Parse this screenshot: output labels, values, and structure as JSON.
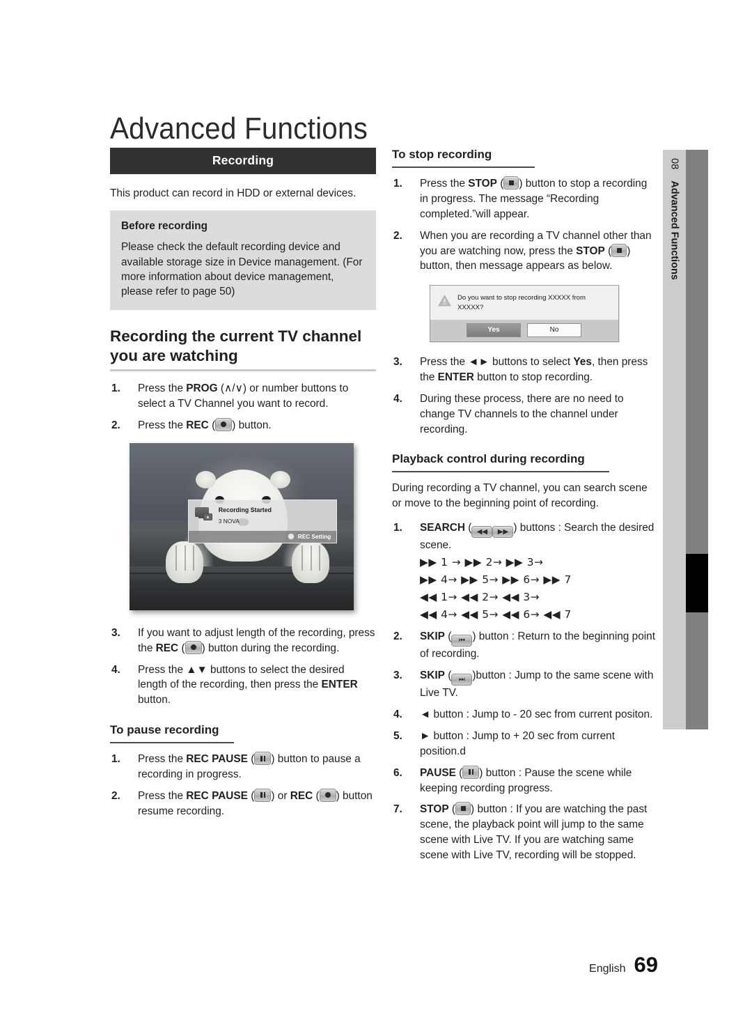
{
  "page_title": "Advanced Functions",
  "section_bar": {
    "label": "Recording"
  },
  "left": {
    "intro": "This product can record in HDD or external devices.",
    "note": {
      "title": "Before recording",
      "body": "Please check the default recording device and available storage size in Device management. (For more information about device management, please refer to page 50)"
    },
    "heading_record_current": "Recording the current TV channel you are watching",
    "steps_record": [
      {
        "num": "1.",
        "text_parts": [
          "Press the ",
          "PROG",
          " (∧/∨) or number buttons to select a TV Channel you want to record."
        ]
      },
      {
        "num": "2.",
        "text_parts": [
          "Press the ",
          "REC",
          " (",
          "rec-icon",
          ") button."
        ]
      }
    ],
    "figure": {
      "osd_title": "Recording Started",
      "osd_channel": "3 NOVA",
      "osd_footer": "REC Setting"
    },
    "steps_record_cont": [
      {
        "num": "3.",
        "text": "If you want to adjust length of the recording, press the REC ( ) button during the recording."
      },
      {
        "num": "4.",
        "text": "Press the ▲▼ buttons to select the desired length of the recording, then press the ENTER button."
      }
    ],
    "heading_pause": "To pause recording",
    "steps_pause": [
      {
        "num": "1.",
        "text": "Press the REC PAUSE ( ) button to pause a recording in progress."
      },
      {
        "num": "2.",
        "text": "Press the REC PAUSE ( ) or REC ( ) button resume recording."
      }
    ]
  },
  "right": {
    "heading_stop": "To stop recording",
    "steps_stop_1": [
      {
        "num": "1.",
        "text": "Press the STOP ( ) button to stop a recording in progress. The message “Recording completed.”will appear."
      },
      {
        "num": "2.",
        "text": "When you are recording a TV channel other than you are watching now, press the STOP ( ) button, then message appears as below."
      }
    ],
    "dialog": {
      "message": "Do you want to stop recording XXXXX from XXXXX?",
      "yes_label": "Yes",
      "no_label": "No"
    },
    "steps_stop_2": [
      {
        "num": "3.",
        "text": "Press the ◄► buttons to select Yes, then press the ENTER button to stop recording."
      },
      {
        "num": "4.",
        "text": "During these process, there are no need to change TV channels to the channel under recording."
      }
    ],
    "heading_playback": "Playback control during recording",
    "playback_intro": "During recording a TV channel, you can search scene or move to the beginning point of recording.",
    "steps_playback": [
      {
        "num": "1.",
        "text": "SEARCH ( ) buttons : Search the desired scene."
      },
      {
        "num": "2.",
        "text": "SKIP ( ) button : Return to the beginning point of recording."
      },
      {
        "num": "3.",
        "text": "SKIP ( )button : Jump to the same scene with Live TV."
      },
      {
        "num": "4.",
        "text": "◄ button : Jump to - 20 sec from current positon."
      },
      {
        "num": "5.",
        "text": "► button : Jump to + 20 sec from current position.d"
      },
      {
        "num": "6.",
        "text": "PAUSE ( ) button : Pause the scene while keeping recording progress."
      },
      {
        "num": "7.",
        "text": "STOP ( ) button : If you are watching the past scene, the playback point will jump to the same scene with Live TV. If you are watching same scene with Live TV, recording will be stopped."
      }
    ],
    "search_sequences": [
      "▶▶ 1 → ▶▶ 2→ ▶▶ 3→",
      "▶▶ 4→ ▶▶ 5→ ▶▶ 6→ ▶▶ 7",
      "◀◀ 1→ ◀◀ 2→ ◀◀ 3→",
      "◀◀ 4→ ◀◀ 5→ ◀◀ 6→ ◀◀ 7"
    ]
  },
  "side_tab": {
    "number": "08",
    "label": "Advanced Functions"
  },
  "footer": {
    "language": "English",
    "page_number": "69"
  },
  "colors": {
    "bar_bg": "#333132",
    "note_bg": "#dcdcdc",
    "tab_light": "#cccccc",
    "tab_dark": "#808080"
  }
}
